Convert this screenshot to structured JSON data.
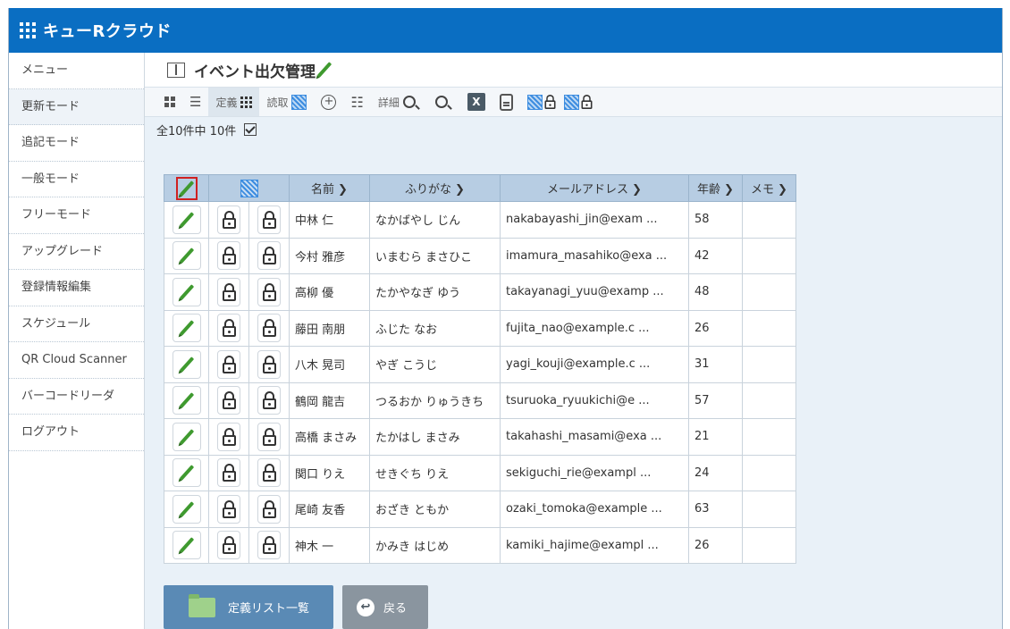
{
  "app": {
    "title": "キューRクラウド"
  },
  "sidebar": {
    "items": [
      {
        "label": "メニュー"
      },
      {
        "label": "更新モード"
      },
      {
        "label": "追記モード"
      },
      {
        "label": "一般モード"
      },
      {
        "label": "フリーモード"
      },
      {
        "label": "アップグレード"
      },
      {
        "label": "登録情報編集"
      },
      {
        "label": "スケジュール"
      },
      {
        "label": "QR Cloud Scanner"
      },
      {
        "label": "バーコードリーダ"
      },
      {
        "label": "ログアウト"
      }
    ]
  },
  "page": {
    "title": "イベント出欠管理"
  },
  "toolbar": {
    "define_label": "定義",
    "read_label": "読取",
    "detail_label": "詳細",
    "excel_label": "X"
  },
  "summary": {
    "text": "全10件中  10件"
  },
  "table": {
    "headers": {
      "name": "名前",
      "furigana": "ふりがな",
      "email": "メールアドレス",
      "age": "年齢",
      "memo": "メモ"
    },
    "rows": [
      {
        "name": "中林 仁",
        "furigana": "なかばやし じん",
        "email": "nakabayashi_jin@exam ...",
        "age": "58",
        "memo": ""
      },
      {
        "name": "今村 雅彦",
        "furigana": "いまむら まさひこ",
        "email": "imamura_masahiko@exa ...",
        "age": "42",
        "memo": ""
      },
      {
        "name": "高柳 優",
        "furigana": "たかやなぎ ゆう",
        "email": "takayanagi_yuu@examp ...",
        "age": "48",
        "memo": ""
      },
      {
        "name": "藤田 南朋",
        "furigana": "ふじた なお",
        "email": "fujita_nao@example.c ...",
        "age": "26",
        "memo": ""
      },
      {
        "name": "八木 晃司",
        "furigana": "やぎ こうじ",
        "email": "yagi_kouji@example.c ...",
        "age": "31",
        "memo": ""
      },
      {
        "name": "鶴岡 龍吉",
        "furigana": "つるおか りゅうきち",
        "email": "tsuruoka_ryuukichi@e ...",
        "age": "57",
        "memo": ""
      },
      {
        "name": "高橋 まさみ",
        "furigana": "たかはし まさみ",
        "email": "takahashi_masami@exa ...",
        "age": "21",
        "memo": ""
      },
      {
        "name": "関口 りえ",
        "furigana": "せきぐち りえ",
        "email": "sekiguchi_rie@exampl ...",
        "age": "24",
        "memo": ""
      },
      {
        "name": "尾崎 友香",
        "furigana": "おざき ともか",
        "email": "ozaki_tomoka@example ...",
        "age": "63",
        "memo": ""
      },
      {
        "name": "神木 一",
        "furigana": "かみき はじめ",
        "email": "kamiki_hajime@exampl ...",
        "age": "26",
        "memo": ""
      }
    ]
  },
  "buttons": {
    "list_label": "定義リスト一覧",
    "back_label": "戻る"
  }
}
